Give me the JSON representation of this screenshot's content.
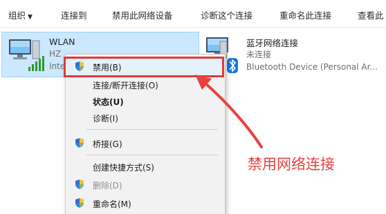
{
  "toolbar": {
    "organize": "组织",
    "connect_to": "连接到",
    "disable_device": "禁用此网络设备",
    "diagnose": "诊断这个连接",
    "rename": "重命名此连接",
    "view_status": "查看此"
  },
  "adapters": {
    "wlan": {
      "name": "WLAN",
      "network": "HZ",
      "device": "Inte"
    },
    "bluetooth": {
      "name": "蓝牙网络连接",
      "status": "未连接",
      "device": "Bluetooth Device (Personal Ar..."
    }
  },
  "context_menu": {
    "items": [
      {
        "label": "禁用(B)",
        "icon": "shield-icon",
        "style": "highlighted"
      },
      {
        "label": "连接/断开连接(O)",
        "icon": "",
        "style": "normal"
      },
      {
        "label": "状态(U)",
        "icon": "",
        "style": "bold"
      },
      {
        "label": "诊断(I)",
        "icon": "",
        "style": "normal"
      },
      {
        "label": "桥接(G)",
        "icon": "shield-icon",
        "style": "normal"
      },
      {
        "label": "创建快捷方式(S)",
        "icon": "",
        "style": "normal"
      },
      {
        "label": "删除(D)",
        "icon": "shield-icon",
        "style": "disabled"
      },
      {
        "label": "重命名(M)",
        "icon": "shield-icon",
        "style": "normal"
      }
    ]
  },
  "annotation": {
    "text": "禁用网络连接",
    "color": "#e8413e"
  },
  "colors": {
    "selection_bg": "#cce8ff",
    "highlight_border": "#e23a3a",
    "signal_green": "#2e9a2e",
    "bluetooth_blue": "#1777d6"
  }
}
